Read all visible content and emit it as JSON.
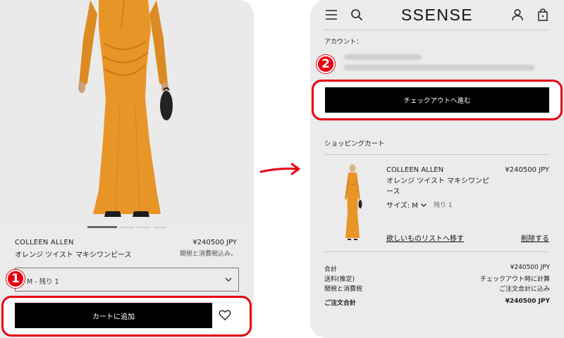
{
  "left_screen": {
    "product": {
      "brand": "COLLEEN ALLEN",
      "name": "オレンジ ツイスト マキシワンピース",
      "price": "¥240500 JPY",
      "tax_note": "関税と消費税込み。",
      "dress_color": "#e89527"
    },
    "size_selector": {
      "value": "M - 残り 1",
      "icon": "chevron-down-icon"
    },
    "add_to_cart_label": "カートに追加",
    "wishlist_icon": "heart-icon",
    "carousel": {
      "count": 4,
      "active_index": 0
    },
    "step_badge": "1"
  },
  "right_screen": {
    "logo": "SSENSE",
    "icons": [
      "menu-icon",
      "search-icon",
      "account-icon",
      "bag-icon"
    ],
    "account_label": "アカウント：",
    "checkout_label": "チェックアウトへ進む",
    "step_badge": "2",
    "cart_heading": "ショッピングカート",
    "item": {
      "brand": "COLLEEN ALLEN",
      "name": "オレンジ ツイスト マキシワンピース",
      "price": "¥240500 JPY",
      "size": "サイズ: M",
      "stock": "残り 1",
      "move_to_wishlist": "欲しいものリストへ移す",
      "remove": "削除する"
    },
    "summary": [
      {
        "label": "合計",
        "value": "¥240500 JPY"
      },
      {
        "label": "送料(推定)",
        "value": "チェックアウト時に計算"
      },
      {
        "label": "関税と消費税",
        "value": "ご注文合計に込み"
      },
      {
        "label": "ご注文合計",
        "value": "¥240500 JPY"
      }
    ]
  },
  "colors": {
    "highlight": "#e60012",
    "button": "#000000",
    "background": "#ebebeb"
  }
}
